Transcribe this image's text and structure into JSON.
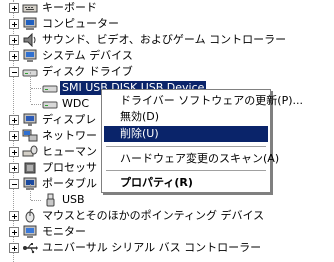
{
  "tree": {
    "items": [
      {
        "label": "キーボード",
        "icon": "keyboard-icon"
      },
      {
        "label": "コンピューター",
        "icon": "computer-icon"
      },
      {
        "label": "サウンド、ビデオ、およびゲーム コントローラー",
        "icon": "speaker-icon"
      },
      {
        "label": "システム デバイス",
        "icon": "system-device-icon"
      },
      {
        "label": "ディスク ドライブ",
        "icon": "disk-drive-icon"
      },
      {
        "label": "SMI USB DISK USB Device",
        "icon": "disk-drive-icon"
      },
      {
        "label": "WDC",
        "icon": "disk-drive-icon"
      },
      {
        "label": "ディスプレ",
        "icon": "display-adapter-icon"
      },
      {
        "label": "ネットワー",
        "icon": "network-icon"
      },
      {
        "label": "ヒューマン",
        "icon": "hid-icon"
      },
      {
        "label": "プロセッサ",
        "icon": "processor-icon"
      },
      {
        "label": "ポータブル",
        "icon": "portable-device-icon"
      },
      {
        "label": "USB",
        "icon": "usb-device-icon"
      },
      {
        "label": "マウスとそのほかのポインティング デバイス",
        "icon": "mouse-icon"
      },
      {
        "label": "モニター",
        "icon": "monitor-icon"
      },
      {
        "label": "ユニバーサル シリアル バス コントローラー",
        "icon": "usb-controller-icon"
      }
    ]
  },
  "context_menu": {
    "items": [
      {
        "label": "ドライバー ソフトウェアの更新(P)..."
      },
      {
        "label": "無効(D)"
      },
      {
        "label": "削除(U)"
      },
      {
        "label": "ハードウェア変更のスキャン(A)"
      },
      {
        "label": "プロパティ(R)"
      }
    ]
  }
}
